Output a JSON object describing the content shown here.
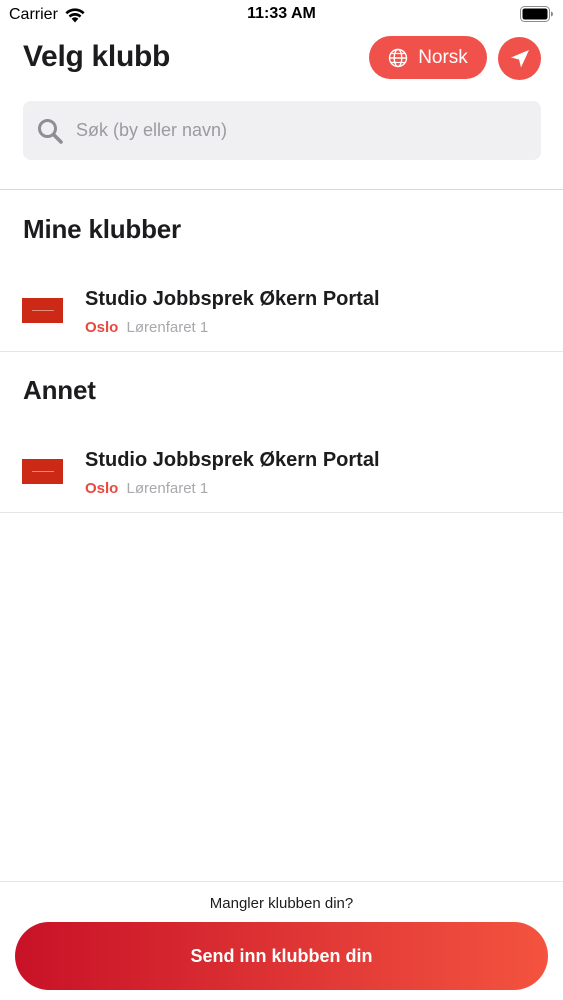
{
  "status_bar": {
    "carrier": "Carrier",
    "time": "11:33 AM"
  },
  "header": {
    "title": "Velg klubb",
    "language_label": "Norsk",
    "accent_color": "#f0514a"
  },
  "search": {
    "placeholder": "Søk (by eller navn)",
    "value": ""
  },
  "sections": {
    "mine": {
      "title": "Mine klubber",
      "clubs": [
        {
          "name": "Studio Jobbsprek Økern Portal",
          "city": "Oslo",
          "address": "Lørenfaret 1"
        }
      ]
    },
    "other": {
      "title": "Annet",
      "clubs": [
        {
          "name": "Studio Jobbsprek Økern Portal",
          "city": "Oslo",
          "address": "Lørenfaret 1"
        }
      ]
    }
  },
  "footer": {
    "missing_text": "Mangler klubben din?",
    "submit_label": "Send inn klubben din"
  },
  "icons": {
    "wifi": "wifi-icon",
    "battery": "battery-icon",
    "globe": "globe-icon",
    "location": "location-arrow-icon",
    "search": "search-icon",
    "club_logo": "club-logo"
  }
}
